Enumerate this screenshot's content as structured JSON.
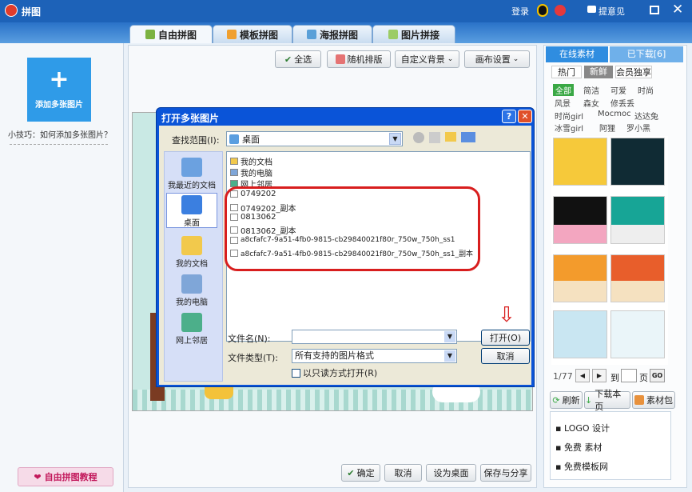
{
  "app": {
    "title": "拼图",
    "login": "登录",
    "feedback": "提意见"
  },
  "tabs": [
    "自由拼图",
    "模板拼图",
    "海报拼图",
    "图片拼接"
  ],
  "left": {
    "add_label": "添加多张图片",
    "tip": "小技巧：如何添加多张图片？",
    "tutorial": "自由拼图教程"
  },
  "toolbar": {
    "select_all": "全选",
    "random": "随机排版",
    "custom_bg": "自定义背景",
    "canvas": "画布设置"
  },
  "bottom": {
    "ok": "确定",
    "cancel": "取消",
    "set_desktop": "设为桌面",
    "save_share": "保存与分享"
  },
  "dialog": {
    "title": "打开多张图片",
    "look_in_label": "查找范围(I):",
    "look_in_value": "桌面",
    "places": [
      "我最近的文档",
      "桌面",
      "我的文档",
      "我的电脑",
      "网上邻居"
    ],
    "files": [
      "我的文档",
      "我的电脑",
      "网上邻居",
      "0749202",
      "0749202_副本",
      "0813062",
      "0813062_副本",
      "a8cfafc7-9a51-4fb0-9815-cb29840021f80r_750w_750h_ss1",
      "a8cfafc7-9a51-4fb0-9815-cb29840021f80r_750w_750h_ss1_副本"
    ],
    "filename_label": "文件名(N):",
    "filename_value": "",
    "filetype_label": "文件类型(T):",
    "filetype_value": "所有支持的图片格式",
    "readonly_label": "以只读方式打开(R)",
    "open": "打开(O)",
    "cancel": "取消"
  },
  "right": {
    "tab_online": "在线素材",
    "tab_downloaded": "已下载[6]",
    "subtabs": [
      "热门",
      "新鲜",
      "会员独享"
    ],
    "tags": [
      "全部",
      "简洁",
      "可爱",
      "时尚",
      "风景",
      "森女",
      "修丢丢",
      "时尚girl",
      "Mocmoc",
      "达达兔",
      "冰雪girl",
      "阿狸",
      "罗小黑"
    ],
    "page": "1/77",
    "goto": "到",
    "page_unit": "页",
    "go": "GO",
    "refresh": "刷新",
    "download_page": "下载本页",
    "pack": "素材包",
    "ads": [
      "LOGO 设计",
      "免费 素材",
      "免费模板网"
    ]
  }
}
